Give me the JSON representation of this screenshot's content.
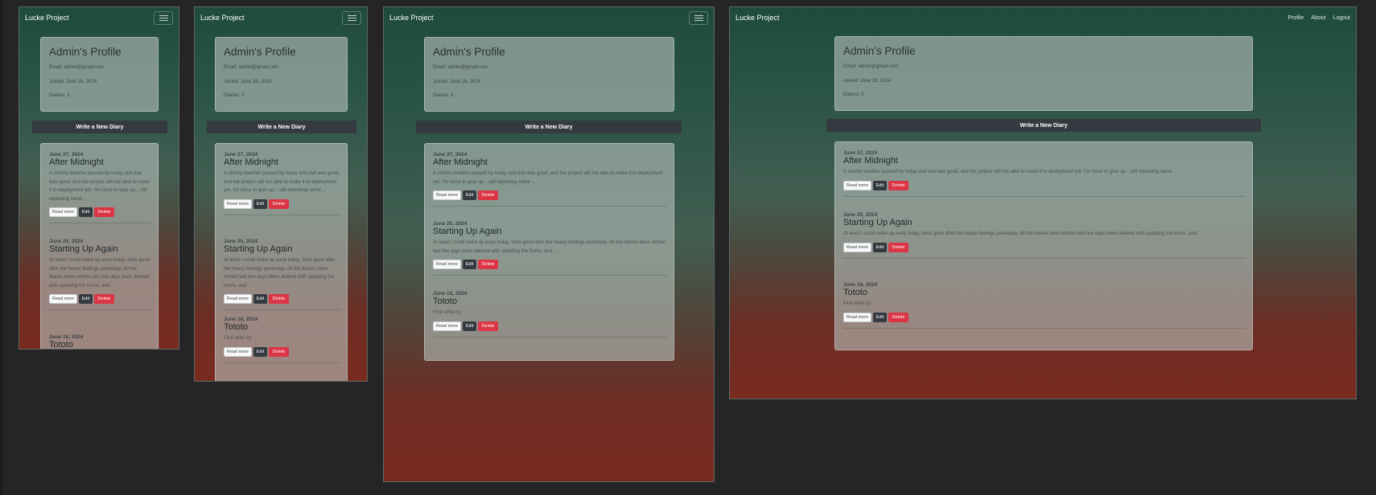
{
  "app": {
    "brand": "Lucke Project",
    "nav": [
      "Profile",
      "About",
      "Logout"
    ]
  },
  "profile": {
    "title": "Admin's Profile",
    "email": "Email: admin@gmail.com",
    "joined": "Joined: June 18, 2024",
    "diaries": "Diaries: 3"
  },
  "write_button": "Write a New Diary",
  "actions": {
    "read": "Read more",
    "edit": "Edit",
    "delete": "Delete"
  },
  "diaries": [
    {
      "date": "June 27, 2024",
      "title": "After Midnight",
      "snippet": "A stormy weather passed by today and that was good, and the project still not able to make it to deployment yet. I'm close to give up... still repeating same ..."
    },
    {
      "date": "June 25, 2024",
      "title": "Starting Up Again",
      "snippet": "At least I could wake up early today, feels good after the heavy feelings yesterday. All the diaries been written last few days been deleted with updating the forms, and ..."
    },
    {
      "date": "June 18, 2024",
      "title": "Tototo",
      "snippet": "First write try"
    }
  ],
  "colors": {
    "background": "#252526",
    "gradient_top": "#1f4a3e",
    "gradient_bottom": "#7a2b20",
    "dark_button": "#343a40",
    "danger": "#dc3545"
  }
}
